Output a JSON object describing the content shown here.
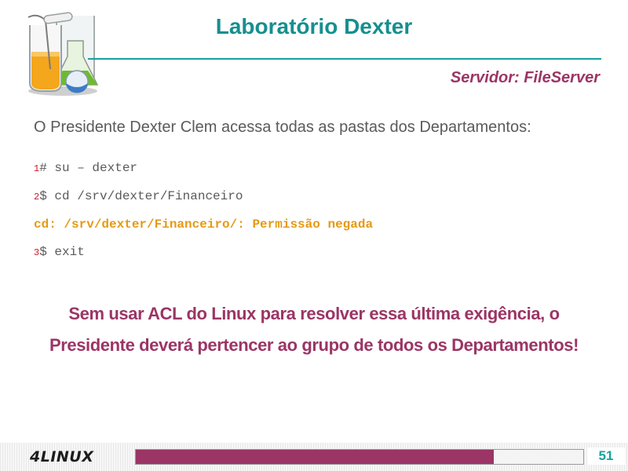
{
  "header": {
    "title": "Laboratório Dexter",
    "subtitle": "Servidor: FileServer"
  },
  "intro": "O Presidente Dexter Clem acessa todas as pastas dos Departamentos:",
  "terminal": [
    {
      "num": "1",
      "text": "# su – dexter"
    },
    {
      "num": "2",
      "text": "$ cd /srv/dexter/Financeiro"
    },
    {
      "num": "",
      "text": "cd: /srv/dexter/Financeiro/: Permissão negada"
    },
    {
      "num": "3",
      "text": "$ exit"
    }
  ],
  "note": {
    "line1": "Sem usar ACL do Linux para resolver essa última exigência, o",
    "line2": "Presidente deverá pertencer ao grupo de todos os Departamentos!"
  },
  "footer": {
    "brand": "4LINUX",
    "progress_fraction": 0.8,
    "page_number": "51"
  },
  "colors": {
    "title": "#168f8f",
    "accent": "#9b3565",
    "error": "#e49a16",
    "line_number": "#d0152a"
  },
  "icons": [
    "lab-flasks-icon"
  ]
}
